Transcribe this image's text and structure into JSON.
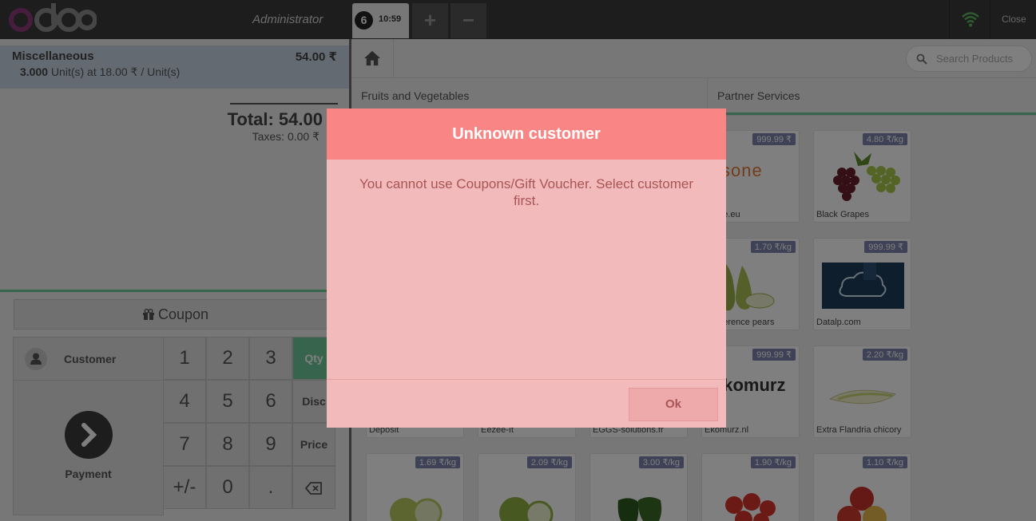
{
  "header": {
    "logo_text": "odoo",
    "user": "Administrator",
    "order_number": "6",
    "order_time": "10:59",
    "add_order_label": "+",
    "remove_order_label": "−",
    "close_label": "Close",
    "wifi_color": "#5cb85c"
  },
  "order": {
    "line": {
      "product": "Miscellaneous",
      "price": "54.00 ₹",
      "quantity": "3.000",
      "detail": "Unit(s) at 18.00 ₹ / Unit(s)"
    },
    "total": "Total: 54.00",
    "taxes": "Taxes: 0.00 ₹"
  },
  "actions": {
    "coupon_label": "Coupon",
    "customer_label": "Customer",
    "payment_label": "Payment"
  },
  "numpad": {
    "keys": [
      "1",
      "2",
      "3",
      "4",
      "5",
      "6",
      "7",
      "8",
      "9",
      "+/-",
      "0",
      "."
    ],
    "modes": [
      "Qty",
      "Disc",
      "Price"
    ],
    "active_mode": "Qty",
    "backspace_icon": "backspace-icon"
  },
  "products_screen": {
    "search_placeholder": "Search Products",
    "categories": [
      "Fruits and Vegetables",
      "Partner Services"
    ],
    "products": [
      {
        "name": "csone.eu",
        "price": "999.99 ₹",
        "logo_text": "csone"
      },
      {
        "name": "Black Grapes",
        "price": "4.80 ₹/kg"
      },
      {
        "name": "Conference pears",
        "price": "1.70 ₹/kg"
      },
      {
        "name": "Datalp.com",
        "price": "999.99 ₹"
      },
      {
        "name": "Deposit",
        "price": ""
      },
      {
        "name": "Eezee-It",
        "price": ""
      },
      {
        "name": "EGGS-solutions.fr",
        "price": ""
      },
      {
        "name": "Ekomurz.nl",
        "price": "999.99 ₹",
        "logo_text": "ekomurz"
      },
      {
        "name": "Extra Flandria chicory",
        "price": "2.20 ₹/kg"
      },
      {
        "name": "",
        "price": "1.69 ₹/kg"
      },
      {
        "name": "",
        "price": "2.09 ₹/kg"
      },
      {
        "name": "",
        "price": "3.00 ₹/kg"
      },
      {
        "name": "",
        "price": "1.90 ₹/kg"
      },
      {
        "name": "",
        "price": "1.10 ₹/kg"
      }
    ]
  },
  "dialog": {
    "title": "Unknown customer",
    "message": "You cannot use Coupons/Gift Voucher. Select customer first.",
    "ok_label": "Ok"
  },
  "colors": {
    "accent_green": "#6ec89b",
    "dialog_header": "#f98685",
    "dialog_body": "#f2babb",
    "price_tag": "#7f82ac"
  }
}
